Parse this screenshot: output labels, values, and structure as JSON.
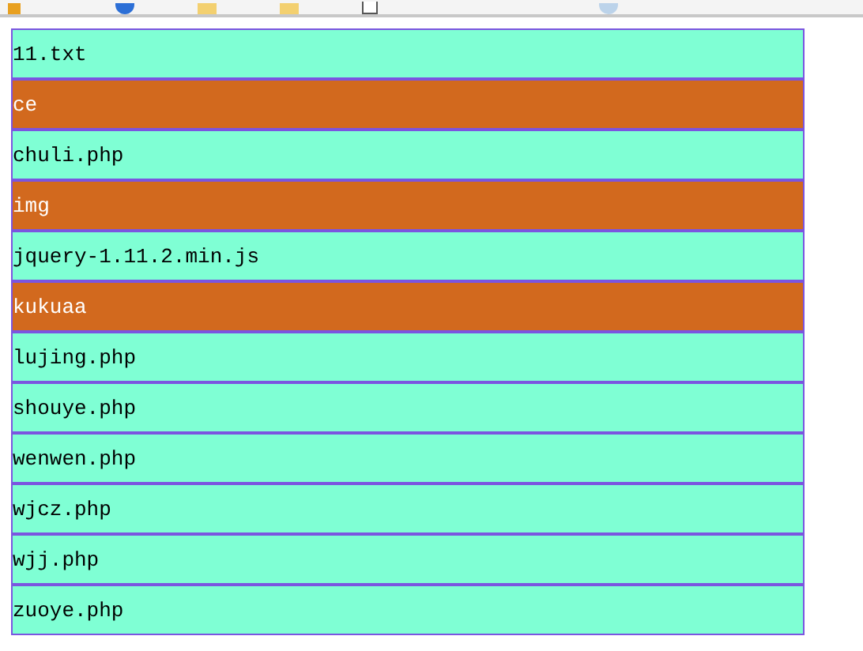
{
  "entries": [
    {
      "name": "11.txt",
      "kind": "file"
    },
    {
      "name": "ce",
      "kind": "folder"
    },
    {
      "name": "chuli.php",
      "kind": "file"
    },
    {
      "name": "img",
      "kind": "folder"
    },
    {
      "name": "jquery-1.11.2.min.js",
      "kind": "file"
    },
    {
      "name": "kukuaa",
      "kind": "folder"
    },
    {
      "name": "lujing.php",
      "kind": "file"
    },
    {
      "name": "shouye.php",
      "kind": "file"
    },
    {
      "name": "wenwen.php",
      "kind": "file"
    },
    {
      "name": "wjcz.php",
      "kind": "file"
    },
    {
      "name": "wjj.php",
      "kind": "file"
    },
    {
      "name": "zuoye.php",
      "kind": "file"
    }
  ]
}
